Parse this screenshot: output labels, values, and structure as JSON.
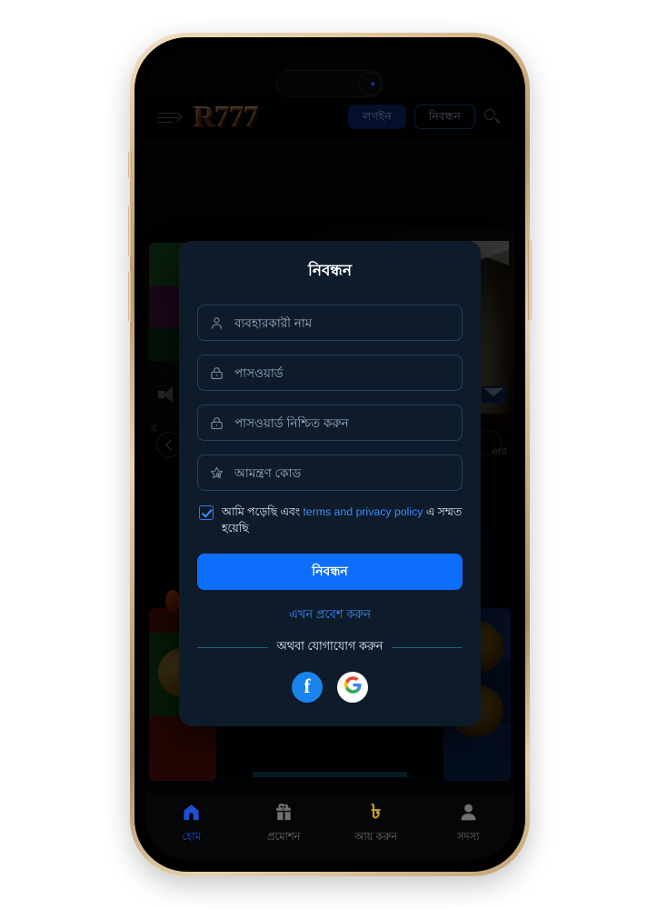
{
  "app": {
    "header": {
      "menu_icon": "menu-arrow-icon",
      "logo_text": "R777",
      "login_label": "লগইন",
      "register_label": "নিবন্ধন",
      "search_icon": "search-icon"
    },
    "background": {
      "prev_icon": "chevron-left-icon",
      "next_icon": "chevron-right-icon",
      "speaker_icon": "speaker-icon",
      "mail_icon": "mail-icon",
      "left_text": "র্ব",
      "right_text": "ent"
    }
  },
  "modal": {
    "title": "নিবন্ধন",
    "fields": [
      {
        "name": "username",
        "icon": "user-icon",
        "placeholder": "ব্যবহারকারী নাম",
        "value": ""
      },
      {
        "name": "password",
        "icon": "lock-icon",
        "placeholder": "পাসওয়ার্ড",
        "value": ""
      },
      {
        "name": "confirm-password",
        "icon": "lock-icon",
        "placeholder": "পাসওয়ার্ড নিশ্চিত করুন",
        "value": ""
      },
      {
        "name": "invite-code",
        "icon": "star-gear-icon",
        "placeholder": "আমন্ত্রণ কোড",
        "value": ""
      }
    ],
    "terms": {
      "checked": true,
      "prefix": "আমি পড়েছি এবং",
      "link": "terms and privacy policy",
      "suffix": "এ সম্মত হয়েছি"
    },
    "submit_label": "নিবন্ধন",
    "login_now_label": "এখন প্রবেশ করুন",
    "divider_label": "অথবা যোগাযোগ করুন",
    "socials": [
      {
        "name": "facebook",
        "glyph": "f"
      },
      {
        "name": "google",
        "glyph": "G"
      }
    ]
  },
  "bottom_nav": [
    {
      "name": "home",
      "icon": "home-icon",
      "label": "হোম",
      "active": true
    },
    {
      "name": "promotion",
      "icon": "gift-icon",
      "label": "প্রমোশন",
      "active": false
    },
    {
      "name": "earn",
      "icon": "taka-icon",
      "label": "আয় করুন",
      "active": false
    },
    {
      "name": "member",
      "icon": "person-icon",
      "label": "সদস্য",
      "active": false
    }
  ],
  "colors": {
    "accent_blue": "#0d6efd",
    "link_blue": "#3d8bff",
    "modal_bg": "#0e1b2a",
    "screen_bg": "#040507",
    "frame_gold": "#d9bd90",
    "taka_gold": "#c6a02a"
  }
}
